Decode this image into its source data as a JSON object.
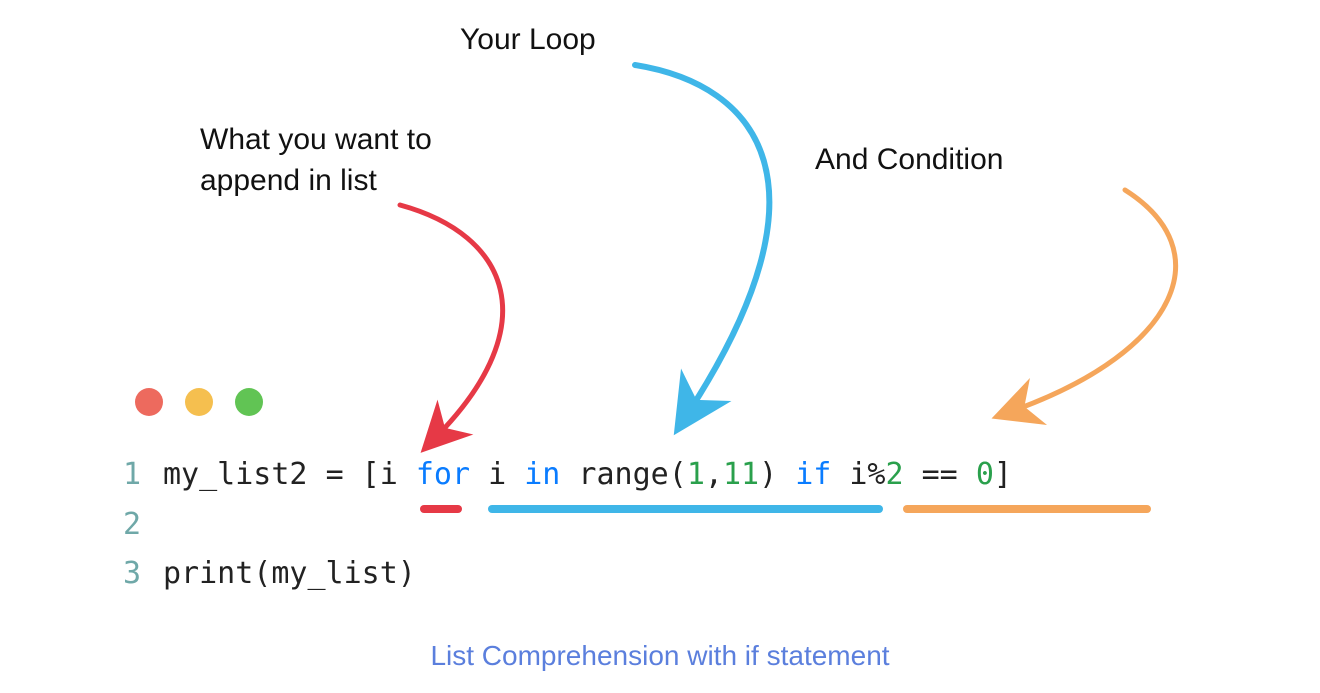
{
  "labels": {
    "loop": "Your Loop",
    "append": "What you want to append in list",
    "condition": "And Condition"
  },
  "code": {
    "line1": {
      "num": "1",
      "tokens": {
        "t0": "my_list2 ",
        "t1": "=",
        "t2": " [i ",
        "t3": "for",
        "t4": " i ",
        "t5": "in",
        "t6": " range(",
        "t7": "1",
        "t8": ",",
        "t9": "11",
        "t10": ") ",
        "t11": "if",
        "t12": " i%",
        "t13": "2",
        "t14": " ",
        "t15": "==",
        "t16": " ",
        "t17": "0",
        "t18": "]"
      }
    },
    "line2": {
      "num": "2"
    },
    "line3": {
      "num": "3",
      "tokens": {
        "t0": "print(my_list)"
      }
    }
  },
  "caption": "List Comprehension with if statement",
  "colors": {
    "red": "#e63946",
    "blue": "#3fb6e8",
    "orange": "#f5a65b"
  }
}
